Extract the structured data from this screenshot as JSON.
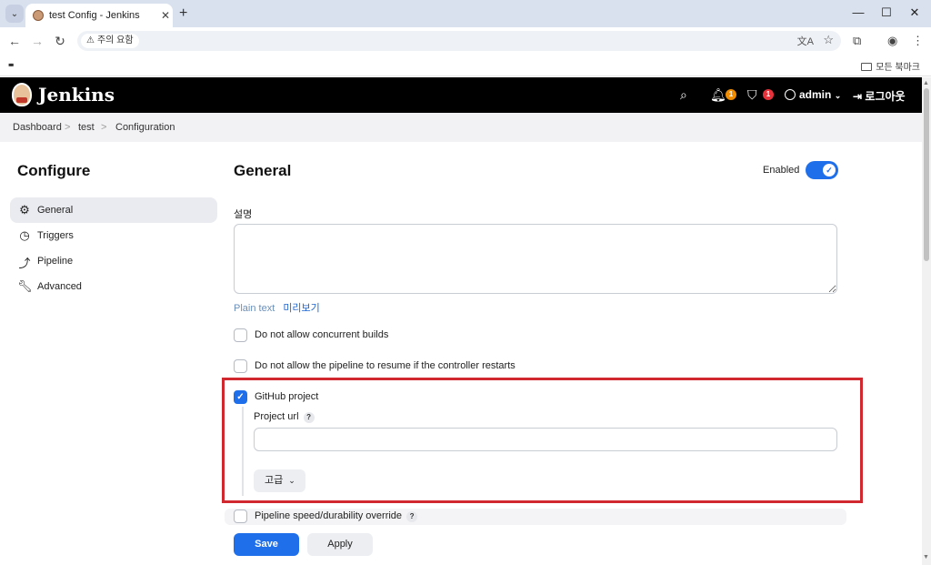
{
  "browser": {
    "tab_title": "test Config - Jenkins",
    "address_chip": "주의 요함",
    "bookmarks_all": "모든 북마크"
  },
  "jenkins": {
    "brand": "Jenkins",
    "notifications_count": "1",
    "security_count": "1",
    "user": "admin",
    "logout": "로그아웃"
  },
  "breadcrumb": {
    "items": [
      "Dashboard",
      "test",
      "Configuration"
    ],
    "separator": ">"
  },
  "sidebar": {
    "title": "Configure",
    "items": [
      {
        "label": "General",
        "icon": "gear-icon"
      },
      {
        "label": "Triggers",
        "icon": "clock-icon"
      },
      {
        "label": "Pipeline",
        "icon": "pipeline-icon"
      },
      {
        "label": "Advanced",
        "icon": "wrench-icon"
      }
    ]
  },
  "main": {
    "title": "General",
    "enabled_label": "Enabled",
    "enabled": true,
    "description_label": "설명",
    "description_value": "",
    "plain_text_label": "Plain text",
    "preview_label": "미리보기",
    "options": [
      {
        "label": "Do not allow concurrent builds",
        "checked": false
      },
      {
        "label": "Do not allow the pipeline to resume if the controller restarts",
        "checked": false
      },
      {
        "label": "GitHub project",
        "checked": true
      },
      {
        "label": "Pipeline speed/durability override",
        "checked": false
      }
    ],
    "github": {
      "project_url_label": "Project url",
      "project_url_value": "",
      "advanced_label": "고급"
    },
    "help_glyph": "?",
    "save_label": "Save",
    "apply_label": "Apply"
  },
  "colors": {
    "accent": "#1f6feb",
    "highlight_border": "#d0282e",
    "header_bg": "#000000"
  }
}
